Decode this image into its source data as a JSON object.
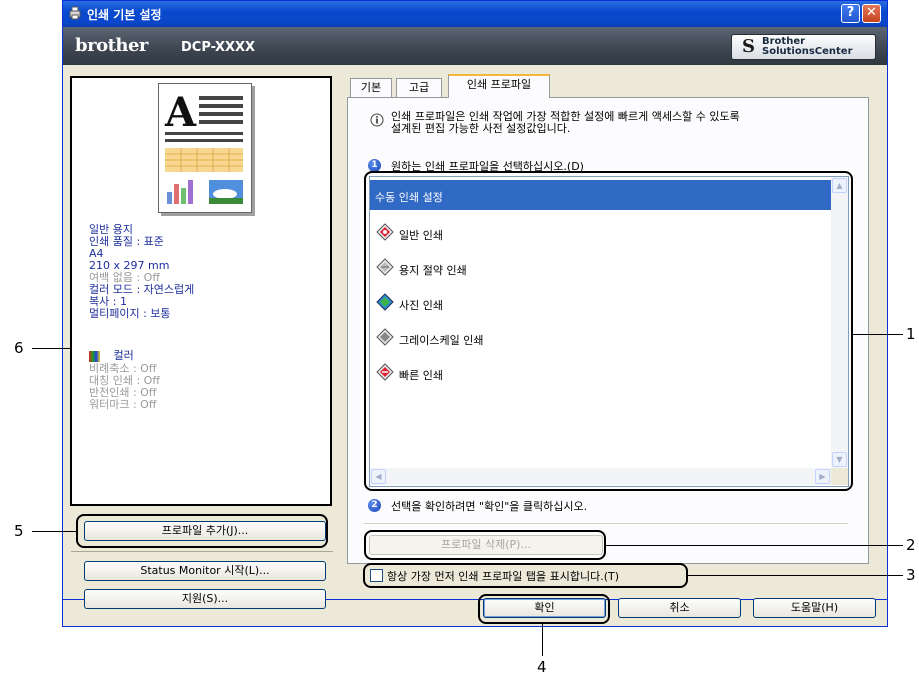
{
  "window": {
    "title": "인쇄 기본 설정",
    "help_button": "?",
    "close_button": "✕"
  },
  "brand": {
    "logo": "brother",
    "model": "DCP-XXXX",
    "solutions_line1": "Brother",
    "solutions_line2": "SolutionsCenter"
  },
  "preview": {
    "summary": [
      {
        "text": "일반 용지",
        "style": "blue"
      },
      {
        "text": "인쇄 품질 : 표준",
        "style": "blue"
      },
      {
        "text": "A4",
        "style": "blue"
      },
      {
        "text": "210 x 297 mm",
        "style": "blue"
      },
      {
        "text": "여백 없음 : Off",
        "style": "gray"
      },
      {
        "text": "컬러 모드 : 자연스럽게",
        "style": "blue"
      },
      {
        "text": "복사 : 1",
        "style": "blue"
      },
      {
        "text": "멀티페이지 : 보통",
        "style": "blue"
      }
    ],
    "color_label": "컬러",
    "extra": [
      "비례축소 : Off",
      "대칭 인쇄 : Off",
      "반전인쇄 : Off",
      "워터마크 : Off"
    ]
  },
  "left_buttons": {
    "add_profile": "프로파일 추가(J)...",
    "status_monitor": "Status Monitor 시작(L)...",
    "support": "지원(S)..."
  },
  "tabs": [
    "기본",
    "고급",
    "인쇄 프로파일"
  ],
  "profile_tab": {
    "intro_line1": "인쇄 프로파일은 인쇄 작업에 가장 적합한 설정에 빠르게 액세스할 수 있도록",
    "intro_line2": "설계된 편집 가능한 사전 설정값입니다.",
    "step1_number": "1",
    "step1_text": "원하는 인쇄 프로파일을 선택하십시오.(D)",
    "profiles": [
      "수동 인쇄 설정",
      "일반 인쇄",
      "용지 절약 인쇄",
      "사진 인쇄",
      "그레이스케일 인쇄",
      "빠른 인쇄"
    ],
    "step2_number": "2",
    "step2_text": "선택을 확인하려면 \"확인\"을 클릭하십시오.",
    "delete_profile": "프로파일 삭제(P)...",
    "always_show": "항상 가장 먼저 인쇄 프로파일 탭을 표시합니다.(T)"
  },
  "bottom_buttons": {
    "ok": "확인",
    "cancel": "취소",
    "help": "도움말(H)"
  },
  "callouts": {
    "c1": "1",
    "c2": "2",
    "c3": "3",
    "c4": "4",
    "c5": "5",
    "c6": "6"
  }
}
